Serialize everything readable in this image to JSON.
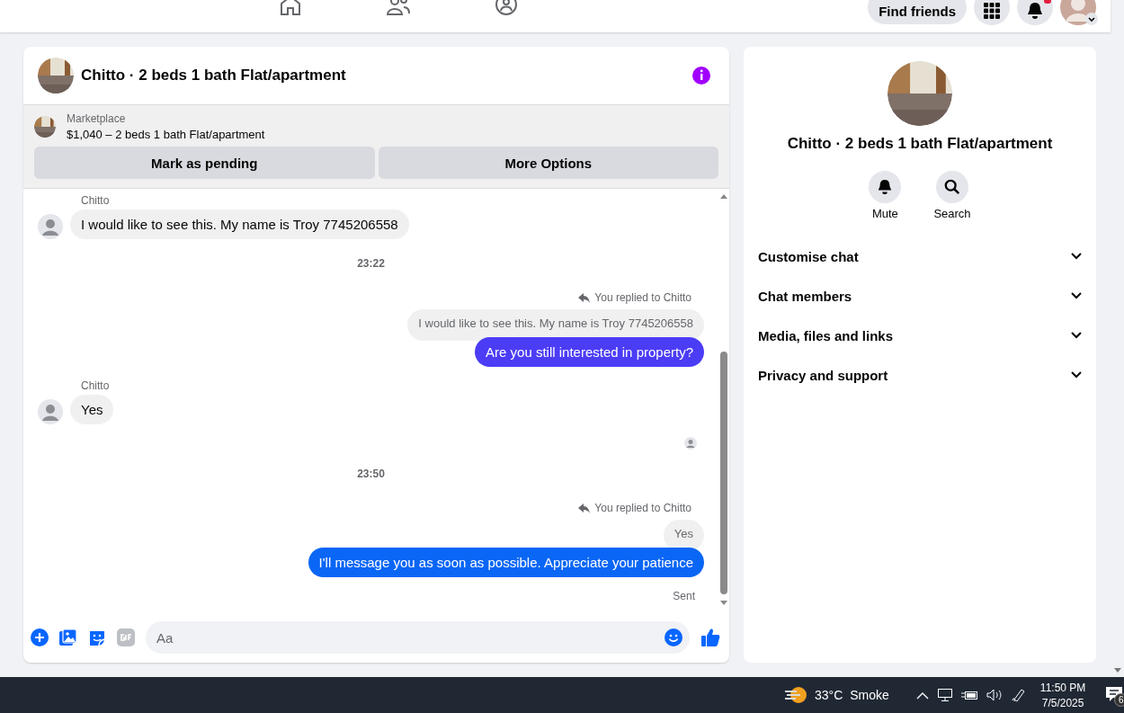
{
  "top_nav": {
    "find_friends": "Find friends",
    "notification_dot": true
  },
  "chat": {
    "title": "Chitto · 2 beds 1 bath Flat/apartment",
    "listing": {
      "source": "Marketplace",
      "summary": "$1,040 – 2 beds 1 bath Flat/apartment"
    },
    "actions": [
      "Mark as pending",
      "More Options"
    ],
    "messages": [
      {
        "kind": "incoming",
        "sender": "Chitto",
        "text": "I would like to see this. My name is Troy 7745206558"
      },
      {
        "kind": "timestamp",
        "text": "23:22"
      },
      {
        "kind": "outgoing",
        "reply_label": "You replied to Chitto",
        "quoted": "I would like to see this. My name is Troy 7745206558",
        "text": "Are you still interested in property?",
        "color": "#4b3cf6"
      },
      {
        "kind": "incoming",
        "sender": "Chitto",
        "text": "Yes"
      },
      {
        "kind": "seen"
      },
      {
        "kind": "timestamp",
        "text": "23:50"
      },
      {
        "kind": "outgoing",
        "reply_label": "You replied to Chitto",
        "quoted": "Yes",
        "text": "I'll message you as soon as possible. Appreciate your patience",
        "color": "#0a66f5"
      },
      {
        "kind": "status",
        "text": "Sent"
      }
    ],
    "composer": {
      "placeholder": "Aa"
    }
  },
  "details": {
    "title": "Chitto · 2 beds 1 bath Flat/apartment",
    "actions": [
      {
        "kind": "bell",
        "label": "Mute"
      },
      {
        "kind": "search",
        "label": "Search"
      }
    ],
    "sections": [
      "Customise chat",
      "Chat members",
      "Media, files and links",
      "Privacy and support"
    ]
  },
  "taskbar": {
    "temperature": "33°C",
    "weather": "Smoke",
    "time": "11:50 PM",
    "date": "7/5/2025",
    "notification_count": "6"
  }
}
